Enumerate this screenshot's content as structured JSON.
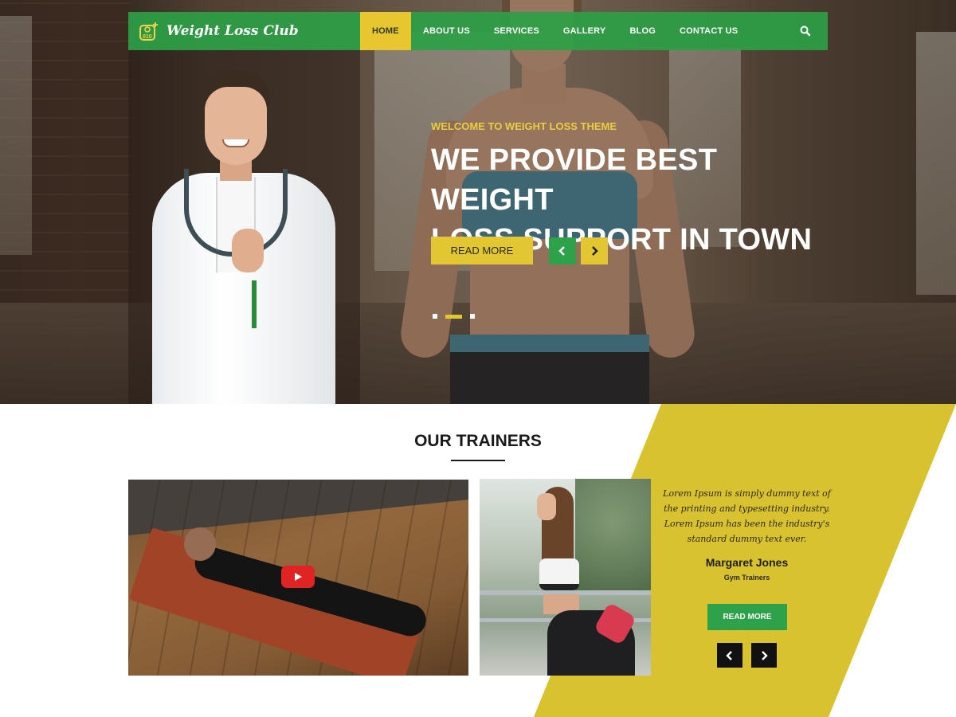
{
  "brand": {
    "name": "Weight Loss Club",
    "accent": "#e2c632",
    "primary": "#2ea24a"
  },
  "nav": {
    "items": [
      {
        "label": "HOME",
        "active": true
      },
      {
        "label": "ABOUT US",
        "active": false
      },
      {
        "label": "SERVICES",
        "active": false
      },
      {
        "label": "GALLERY",
        "active": false
      },
      {
        "label": "BLOG",
        "active": false
      },
      {
        "label": "CONTACT US",
        "active": false
      }
    ],
    "search_icon": "search-icon"
  },
  "hero": {
    "subtitle": "WELCOME TO WEIGHT LOSS THEME",
    "title_line1": "WE PROVIDE BEST WEIGHT",
    "title_line2": "LOSS SUPPORT IN TOWN",
    "cta_label": "READ MORE",
    "slides": 3,
    "active_slide": 2
  },
  "trainers": {
    "section_title": "OUR TRAINERS",
    "testimonial": {
      "quote": "Lorem Ipsum is simply dummy text of the printing and typesetting industry. Lorem Ipsum has been the industry's standard dummy text ever.",
      "name": "Margaret Jones",
      "role": "Gym Trainers",
      "button_label": "READ MORE"
    }
  }
}
